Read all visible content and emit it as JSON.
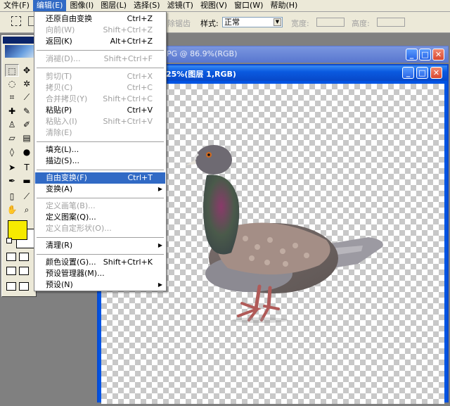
{
  "menubar": [
    "文件(F)",
    "编辑(E)",
    "图像(I)",
    "图层(L)",
    "选择(S)",
    "滤镜(T)",
    "视图(V)",
    "窗口(W)",
    "帮助(H)"
  ],
  "options": {
    "feather": "除锯齿",
    "style_label": "样式:",
    "style_value": "正常",
    "width_label": "宽度:",
    "height_label": "高度:"
  },
  "windows": {
    "back_title": "PG @ 86.9%(RGB)",
    "front_title": "25%(图层 1,RGB)"
  },
  "edit_menu": [
    {
      "label": "还原自由变换",
      "shortcut": "Ctrl+Z",
      "enabled": true
    },
    {
      "label": "向前(W)",
      "shortcut": "Shift+Ctrl+Z",
      "enabled": false
    },
    {
      "label": "返回(K)",
      "shortcut": "Alt+Ctrl+Z",
      "enabled": true
    },
    {
      "sep": true
    },
    {
      "label": "消褪(D)...",
      "shortcut": "Shift+Ctrl+F",
      "enabled": false
    },
    {
      "sep": true
    },
    {
      "label": "剪切(T)",
      "shortcut": "Ctrl+X",
      "enabled": false
    },
    {
      "label": "拷贝(C)",
      "shortcut": "Ctrl+C",
      "enabled": false
    },
    {
      "label": "合并拷贝(Y)",
      "shortcut": "Shift+Ctrl+C",
      "enabled": false
    },
    {
      "label": "粘贴(P)",
      "shortcut": "Ctrl+V",
      "enabled": true
    },
    {
      "label": "粘贴入(I)",
      "shortcut": "Shift+Ctrl+V",
      "enabled": false
    },
    {
      "label": "清除(E)",
      "shortcut": "",
      "enabled": false
    },
    {
      "sep": true
    },
    {
      "label": "填充(L)...",
      "shortcut": "",
      "enabled": true
    },
    {
      "label": "描边(S)...",
      "shortcut": "",
      "enabled": true
    },
    {
      "sep": true
    },
    {
      "label": "自由变换(F)",
      "shortcut": "Ctrl+T",
      "enabled": true,
      "highlight": true
    },
    {
      "label": "变换(A)",
      "shortcut": "",
      "enabled": true,
      "submenu": true
    },
    {
      "sep": true
    },
    {
      "label": "定义画笔(B)...",
      "shortcut": "",
      "enabled": false
    },
    {
      "label": "定义图案(Q)...",
      "shortcut": "",
      "enabled": true
    },
    {
      "label": "定义自定形状(O)...",
      "shortcut": "",
      "enabled": false
    },
    {
      "sep": true
    },
    {
      "label": "清理(R)",
      "shortcut": "",
      "enabled": true,
      "submenu": true
    },
    {
      "sep": true
    },
    {
      "label": "颜色设置(G)...",
      "shortcut": "Shift+Ctrl+K",
      "enabled": true
    },
    {
      "label": "预设管理器(M)...",
      "shortcut": "",
      "enabled": true
    },
    {
      "label": "预设(N)",
      "shortcut": "",
      "enabled": true,
      "submenu": true
    }
  ],
  "colors": {
    "foreground": "#f6ea00",
    "background": "#ffffff",
    "highlight": "#316ac5"
  }
}
